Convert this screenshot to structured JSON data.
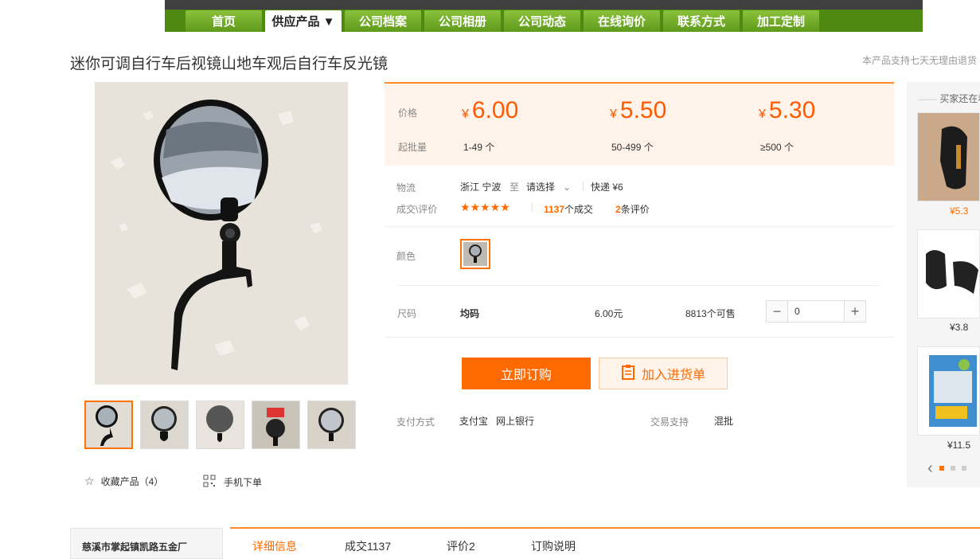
{
  "nav": {
    "items": [
      "首页",
      "供应产品 ▼",
      "公司档案",
      "公司相册",
      "公司动态",
      "在线询价",
      "联系方式",
      "加工定制"
    ],
    "active_index": 1
  },
  "product": {
    "title": "迷你可调自行车后视镜山地车观后自行车反光镜",
    "return_note": "本产品支持七天无理由退货"
  },
  "actions": {
    "favorite_label": "收藏产品（4）",
    "mobile_label": "手机下单"
  },
  "pricing": {
    "price_label": "价格",
    "moq_label": "起批量",
    "currency": "¥",
    "tiers": [
      {
        "price": "6.00",
        "range": "1-49 个"
      },
      {
        "price": "5.50",
        "range": "50-499 个"
      },
      {
        "price": "5.30",
        "range": "≥500 个"
      }
    ]
  },
  "logistics": {
    "label": "物流",
    "origin": "浙江 宁波",
    "to": "至",
    "dest": "请选择",
    "express": "快递 ¥6"
  },
  "reviews": {
    "label": "成交\\评价",
    "stars": "★★★★★",
    "deals_num": "1137",
    "deals_text": "个成交",
    "review_num": "2",
    "review_text": "条评价"
  },
  "options": {
    "color_label": "颜色",
    "size_label": "尺码",
    "size_value": "均码",
    "unit_price": "6.00元",
    "stock": "8813个可售",
    "quantity": "0"
  },
  "buttons": {
    "buy": "立即订购",
    "cart": "加入进货单"
  },
  "payment": {
    "label": "支付方式",
    "methods": "支付宝   网上银行",
    "trade_label": "交易支持",
    "trade_value": "混批"
  },
  "side": {
    "heading": "买家还在看",
    "prices": [
      "¥5.3",
      "¥3.8",
      "¥11.5"
    ]
  },
  "bottom": {
    "company": "慈溪市掌起镇凯路五金厂",
    "tabs": [
      "详细信息",
      "成交1137",
      "评价2",
      "订购说明"
    ]
  },
  "colors": {
    "accent": "#ff6a00",
    "nav_green": "#6ba524"
  }
}
